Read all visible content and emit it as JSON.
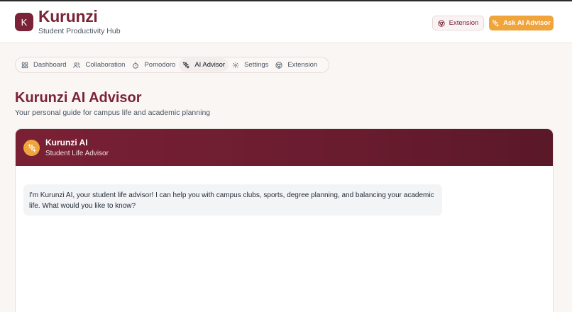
{
  "app": {
    "logo_letter": "K",
    "title": "Kurunzi",
    "subtitle": "Student Productivity Hub"
  },
  "header_actions": {
    "extension_label": "Extension",
    "extension_icon": "chrome-icon",
    "ask_label": "Ask AI Advisor",
    "ask_icon": "sparkles-icon"
  },
  "tabs": [
    {
      "label": "Dashboard",
      "icon": "grid-icon",
      "active": false
    },
    {
      "label": "Collaboration",
      "icon": "users-icon",
      "active": false
    },
    {
      "label": "Pomodoro",
      "icon": "timer-icon",
      "active": false
    },
    {
      "label": "AI Advisor",
      "icon": "sparkles-icon",
      "active": true
    },
    {
      "label": "Settings",
      "icon": "gear-icon",
      "active": false
    },
    {
      "label": "Extension",
      "icon": "chrome-icon",
      "active": false
    }
  ],
  "page": {
    "title": "Kurunzi AI Advisor",
    "subtitle": "Your personal guide for campus life and academic planning"
  },
  "chat": {
    "assistant_name": "Kurunzi AI",
    "assistant_role": "Student Life Advisor",
    "messages": [
      {
        "sender": "assistant",
        "text": "I'm Kurunzi AI, your student life advisor! I can help you with campus clubs, sports, degree planning, and balancing your academic life. What would you like to know?"
      }
    ]
  },
  "colors": {
    "brand": "#7b2336",
    "accent": "#f0a43c",
    "background": "#faf6f3"
  }
}
